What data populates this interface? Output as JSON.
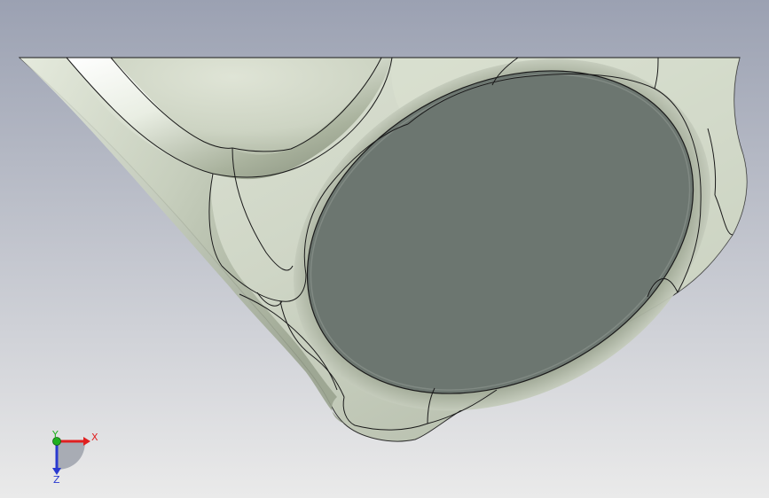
{
  "viewport": {
    "background_top": "#9ba1b2",
    "background_bottom": "#eaeaea"
  },
  "model": {
    "body_color": "#cfd6c6",
    "highlight_color": "#f2f5ef",
    "shadow_color": "#7f8876",
    "flat_face_color": "#6c7670",
    "edge_color": "#1a1a1a"
  },
  "triad": {
    "x_label": "X",
    "y_label": "Y",
    "z_label": "Z",
    "x_color": "#e02020",
    "y_color": "#20b020",
    "z_color": "#2a3ad0"
  }
}
